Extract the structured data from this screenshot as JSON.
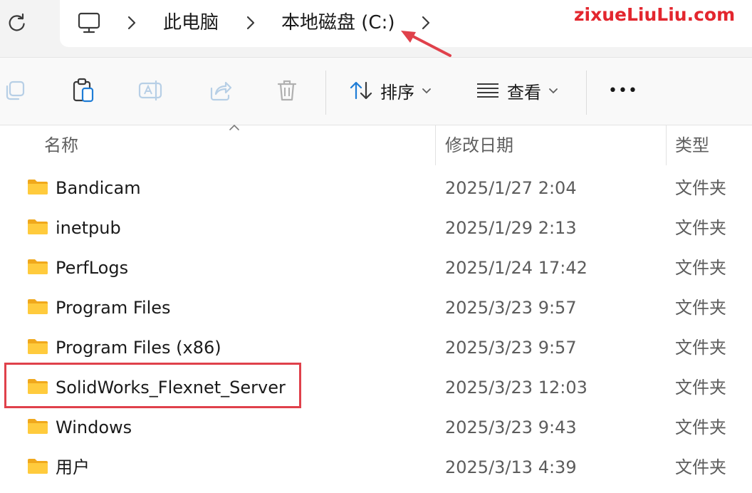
{
  "watermark": "zixueLiuLiu.com",
  "address_bar": {
    "crumbs": [
      "此电脑",
      "本地磁盘 (C:)"
    ],
    "icons": {
      "refresh": "refresh-icon",
      "location": "computer-icon",
      "separator": "chevron-right-icon"
    }
  },
  "toolbar": {
    "icons": [
      "copy-icon",
      "paste-icon",
      "rename-icon",
      "share-icon",
      "delete-icon"
    ],
    "sort_label": "排序",
    "view_label": "查看",
    "more_label": "•••"
  },
  "columns": {
    "name": "名称",
    "modified": "修改日期",
    "type": "类型"
  },
  "files": [
    {
      "name": "Bandicam",
      "modified": "2025/1/27 2:04",
      "type": "文件夹"
    },
    {
      "name": "inetpub",
      "modified": "2025/1/29 2:13",
      "type": "文件夹"
    },
    {
      "name": "PerfLogs",
      "modified": "2025/1/24 17:42",
      "type": "文件夹"
    },
    {
      "name": "Program Files",
      "modified": "2025/3/23 9:57",
      "type": "文件夹"
    },
    {
      "name": "Program Files (x86)",
      "modified": "2025/3/23 9:57",
      "type": "文件夹"
    },
    {
      "name": "SolidWorks_Flexnet_Server",
      "modified": "2025/3/23 12:03",
      "type": "文件夹"
    },
    {
      "name": "Windows",
      "modified": "2025/3/23 9:43",
      "type": "文件夹"
    },
    {
      "name": "用户",
      "modified": "2025/3/13 4:39",
      "type": "文件夹"
    }
  ],
  "colors": {
    "folder_yellow": "#ffcb3d",
    "folder_dark": "#f0a81c",
    "annotation_red": "#e0414b",
    "watermark_red": "#e3262e"
  }
}
